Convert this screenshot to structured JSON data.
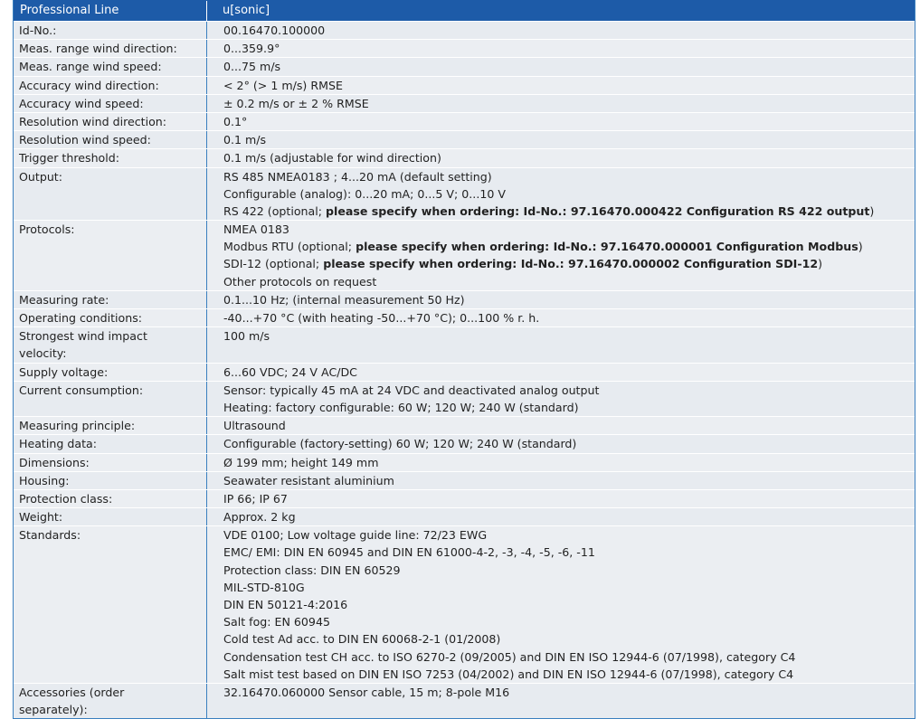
{
  "header": {
    "left": "Professional Line",
    "right": "u[sonic]"
  },
  "rows": [
    {
      "label": [
        "Id-No.:"
      ],
      "values": [
        [
          "00.16470.100000"
        ]
      ]
    },
    {
      "label": [
        "Meas. range wind direction:"
      ],
      "values": [
        [
          "0...359.9°"
        ]
      ]
    },
    {
      "label": [
        "Meas. range wind speed:"
      ],
      "values": [
        [
          "0...75 m/s"
        ]
      ]
    },
    {
      "label": [
        "Accuracy wind direction:"
      ],
      "values": [
        [
          "< 2° (> 1 m/s) RMSE"
        ]
      ]
    },
    {
      "label": [
        "Accuracy wind speed:"
      ],
      "values": [
        [
          "± 0.2 m/s or ± 2 % RMSE"
        ]
      ]
    },
    {
      "label": [
        "Resolution wind direction:"
      ],
      "values": [
        [
          "0.1°"
        ]
      ]
    },
    {
      "label": [
        "Resolution wind speed:"
      ],
      "values": [
        [
          "0.1 m/s"
        ]
      ]
    },
    {
      "label": [
        "Trigger threshold:"
      ],
      "values": [
        [
          "0.1 m/s (adjustable for wind direction)"
        ]
      ]
    },
    {
      "label": [
        "Output:"
      ],
      "values": [
        [
          "RS 485 NMEA0183 ; 4...20 mA (default setting)"
        ],
        [
          "Configurable (analog): 0...20 mA; 0...5 V; 0...10 V"
        ],
        [
          "RS 422 (optional; ",
          "please specify when ordering: Id-No.: 97.16470.000422 Configuration RS 422 output",
          ")"
        ]
      ]
    },
    {
      "label": [
        "Protocols:"
      ],
      "values": [
        [
          "NMEA 0183"
        ],
        [
          "Modbus RTU (optional; ",
          "please specify when ordering: Id-No.: 97.16470.000001 Configuration Modbus",
          ")"
        ],
        [
          "SDI-12 (optional; ",
          "please specify when ordering: Id-No.: 97.16470.000002 Configuration SDI-12",
          ")"
        ],
        [
          "Other protocols on request"
        ]
      ]
    },
    {
      "label": [
        "Measuring rate:"
      ],
      "values": [
        [
          "0.1...10 Hz; (internal measurement 50 Hz)"
        ]
      ]
    },
    {
      "label": [
        "Operating conditions:"
      ],
      "values": [
        [
          "-40...+70 °C (with heating -50...+70 °C); 0...100 % r. h."
        ]
      ]
    },
    {
      "label": [
        "Strongest wind impact",
        "velocity:"
      ],
      "values": [
        [
          "100 m/s"
        ],
        [
          ""
        ]
      ]
    },
    {
      "label": [
        "Supply voltage:"
      ],
      "values": [
        [
          "6...60 VDC; 24 V AC/DC"
        ]
      ]
    },
    {
      "label": [
        "Current consumption:"
      ],
      "values": [
        [
          "Sensor: typically 45 mA at 24 VDC and deactivated analog output"
        ],
        [
          "Heating: factory configurable: 60 W; 120 W; 240 W (standard)"
        ]
      ]
    },
    {
      "label": [
        "Measuring principle:"
      ],
      "values": [
        [
          "Ultrasound"
        ]
      ]
    },
    {
      "label": [
        "Heating data:"
      ],
      "values": [
        [
          "Configurable (factory-setting) 60 W; 120 W; 240 W (standard)"
        ]
      ]
    },
    {
      "label": [
        "Dimensions:"
      ],
      "values": [
        [
          "Ø 199 mm; height 149 mm"
        ]
      ]
    },
    {
      "label": [
        "Housing:"
      ],
      "values": [
        [
          "Seawater resistant aluminium"
        ]
      ]
    },
    {
      "label": [
        "Protection class:"
      ],
      "values": [
        [
          "IP 66; IP 67"
        ]
      ]
    },
    {
      "label": [
        "Weight:"
      ],
      "values": [
        [
          "Approx. 2 kg"
        ]
      ]
    },
    {
      "label": [
        "Standards:"
      ],
      "values": [
        [
          "VDE 0100; Low voltage guide line: 72/23 EWG"
        ],
        [
          "EMC/ EMI: DIN EN 60945 and DIN EN 61000-4-2, -3, -4, -5, -6, -11"
        ],
        [
          "Protection class: DIN EN 60529"
        ],
        [
          "MIL-STD-810G"
        ],
        [
          "DIN EN 50121-4:2016"
        ],
        [
          "Salt fog: EN 60945"
        ],
        [
          "Cold test Ad acc. to DIN EN 60068-2-1 (01/2008)"
        ],
        [
          "Condensation test CH acc. to ISO 6270-2 (09/2005) and DIN EN ISO 12944-6 (07/1998), category C4"
        ],
        [
          "Salt mist test based on DIN EN ISO 7253 (04/2002) and DIN EN ISO 12944-6 (07/1998), category C4"
        ]
      ]
    },
    {
      "label": [
        "Accessories (order",
        "separately):"
      ],
      "values": [
        [
          "32.16470.060000 Sensor cable, 15 m; 8-pole M16"
        ],
        [
          ""
        ]
      ]
    }
  ]
}
